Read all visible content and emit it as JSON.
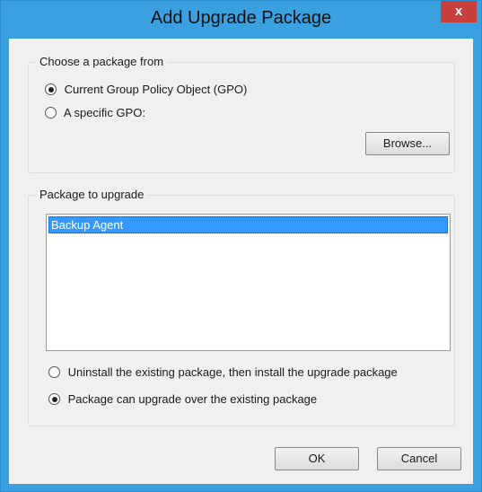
{
  "dialog": {
    "title": "Add Upgrade Package",
    "close_label": "x"
  },
  "source_group": {
    "label": "Choose a package from",
    "options": [
      {
        "label": "Current Group Policy Object (GPO)",
        "checked": true
      },
      {
        "label": "A specific GPO:",
        "checked": false
      }
    ],
    "browse_label": "Browse..."
  },
  "package_group": {
    "label": "Package to upgrade",
    "list_items": [
      {
        "label": "Backup Agent",
        "selected": true
      }
    ],
    "options": [
      {
        "label": "Uninstall the existing package, then install the upgrade package",
        "checked": false
      },
      {
        "label": "Package can upgrade over the existing package",
        "checked": true
      }
    ]
  },
  "buttons": {
    "ok_label": "OK",
    "cancel_label": "Cancel"
  },
  "colors": {
    "frame": "#3aa0e0",
    "close": "#c8403c",
    "selection": "#3399ff"
  }
}
